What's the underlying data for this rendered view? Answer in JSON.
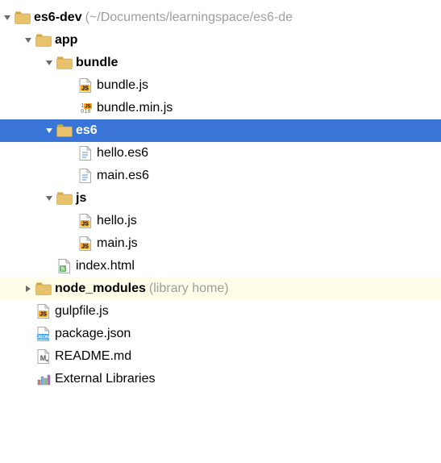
{
  "tree": {
    "root": {
      "name": "es6-dev",
      "path_hint": "(~/Documents/learningspace/es6-de",
      "expanded": true,
      "children": [
        {
          "name": "app",
          "type": "folder",
          "expanded": true,
          "children": [
            {
              "name": "bundle",
              "type": "folder",
              "expanded": true,
              "children": [
                {
                  "name": "bundle.js",
                  "type": "js"
                },
                {
                  "name": "bundle.min.js",
                  "type": "minjs"
                }
              ]
            },
            {
              "name": "es6",
              "type": "folder",
              "expanded": true,
              "selected": true,
              "children": [
                {
                  "name": "hello.es6",
                  "type": "text"
                },
                {
                  "name": "main.es6",
                  "type": "text"
                }
              ]
            },
            {
              "name": "js",
              "type": "folder",
              "expanded": true,
              "children": [
                {
                  "name": "hello.js",
                  "type": "js"
                },
                {
                  "name": "main.js",
                  "type": "js"
                }
              ]
            },
            {
              "name": "index.html",
              "type": "html"
            }
          ]
        },
        {
          "name": "node_modules",
          "type": "folder",
          "expanded": false,
          "highlighted": true,
          "hint": "(library home)"
        },
        {
          "name": "gulpfile.js",
          "type": "js"
        },
        {
          "name": "package.json",
          "type": "json"
        },
        {
          "name": "README.md",
          "type": "md"
        }
      ]
    },
    "external_libraries": {
      "name": "External Libraries"
    }
  }
}
